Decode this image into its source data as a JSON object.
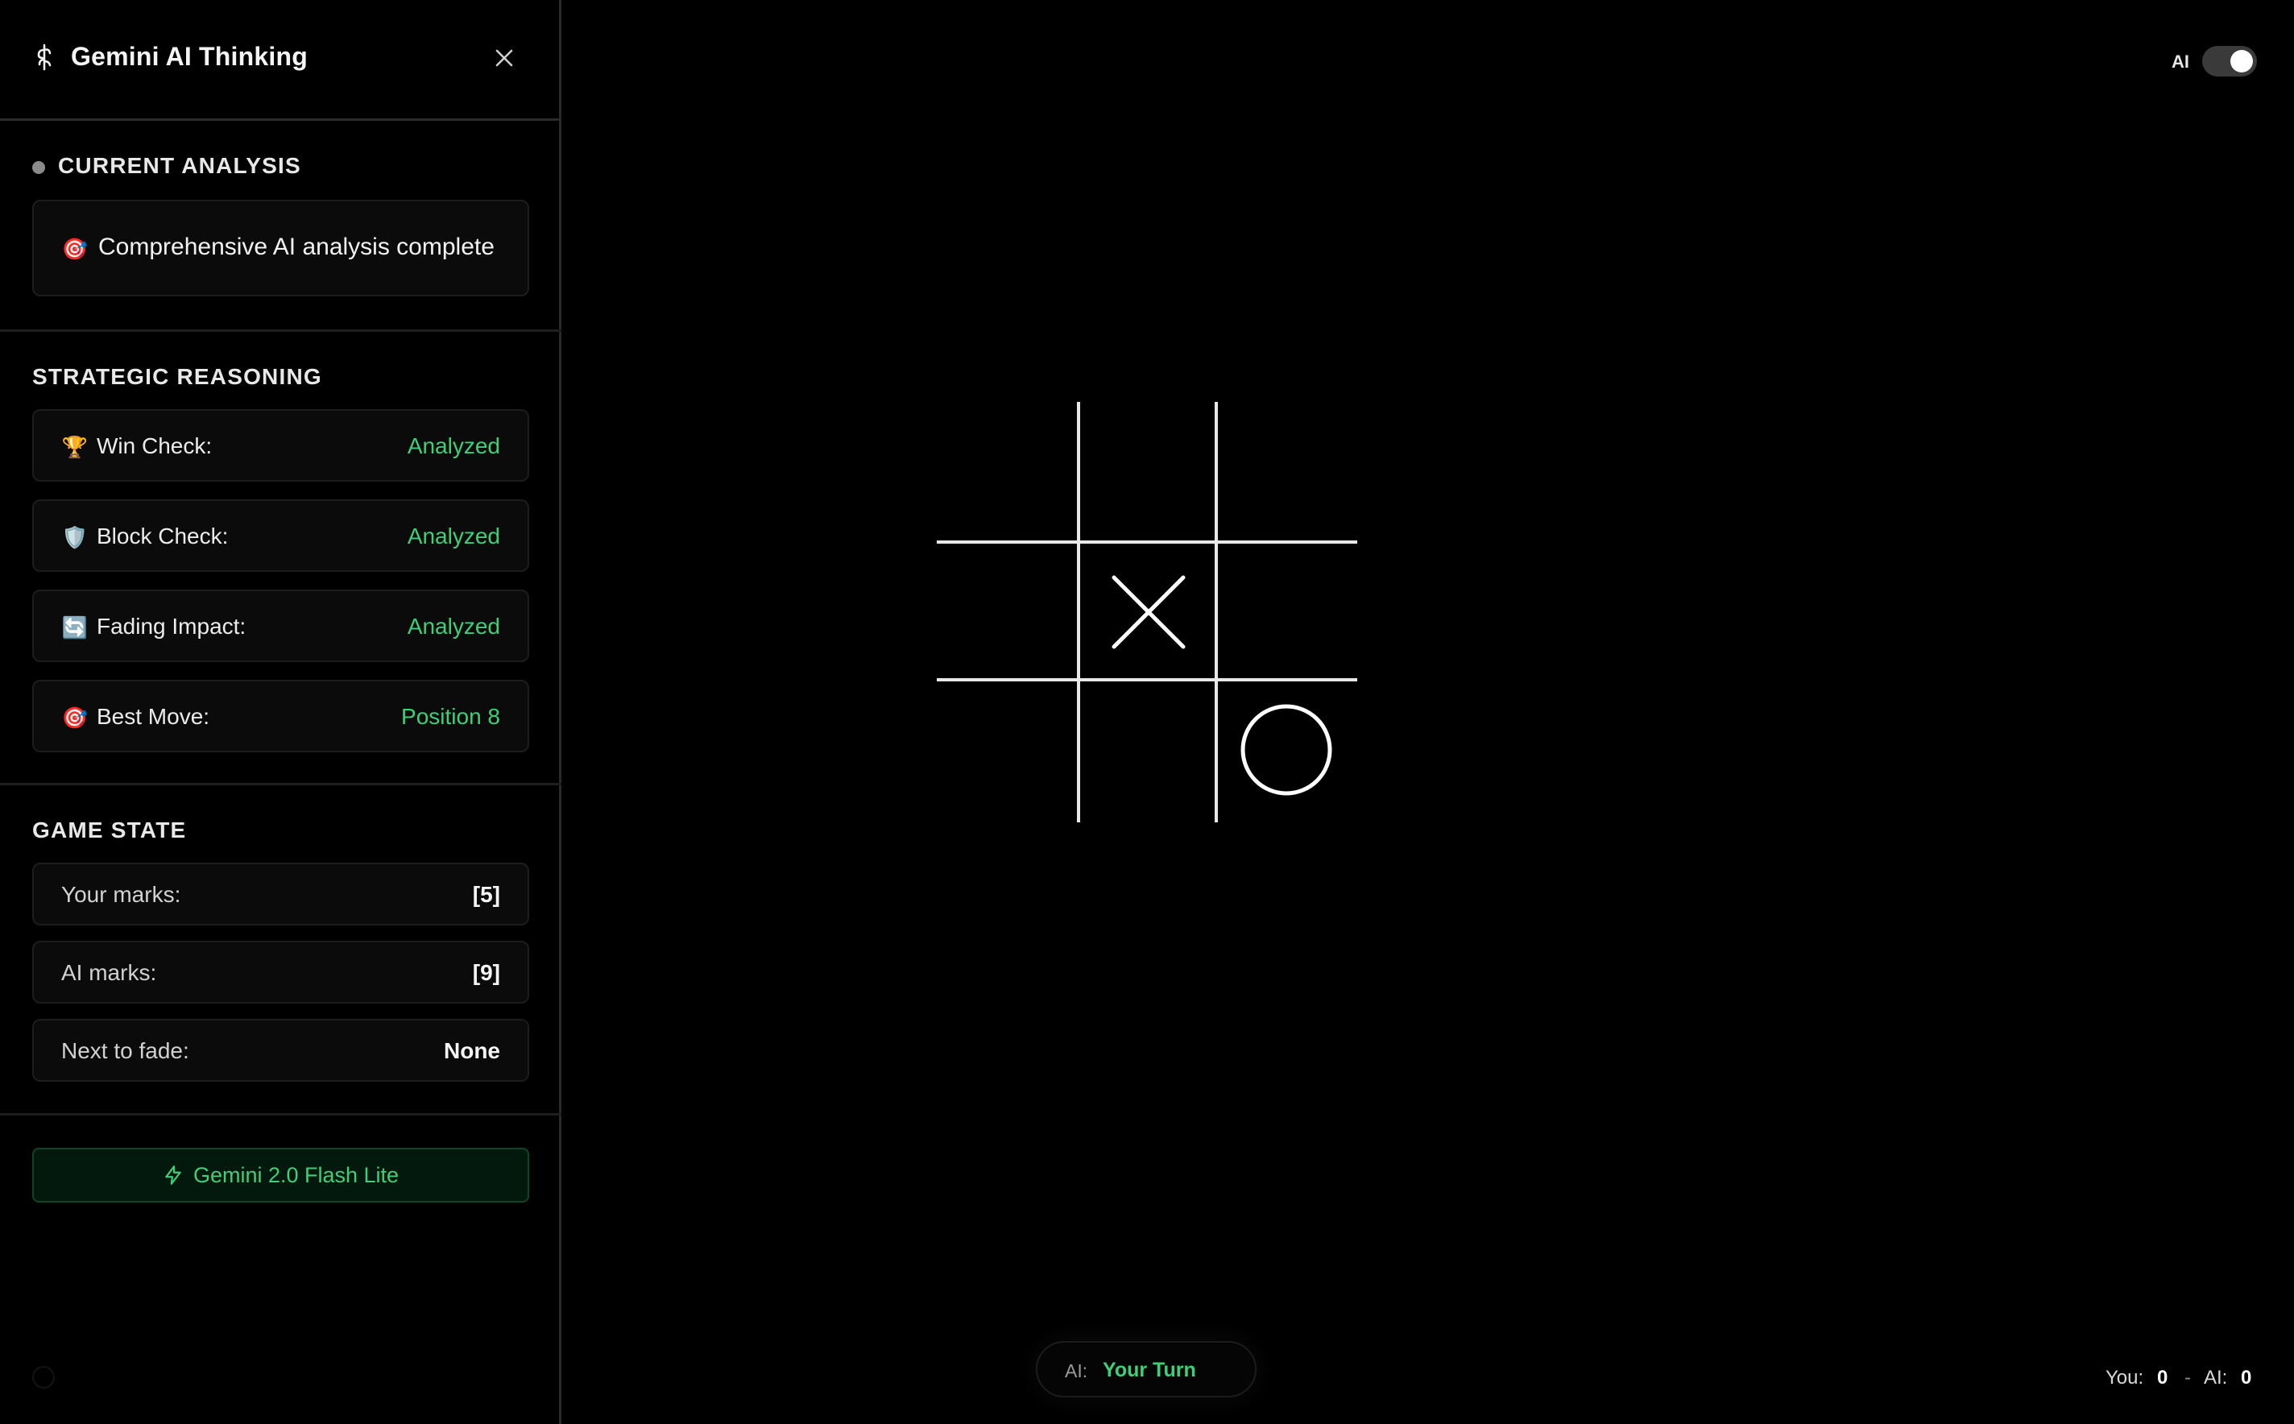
{
  "sidebar": {
    "title": "Gemini AI Thinking",
    "current_analysis": {
      "heading": "CURRENT ANALYSIS",
      "emoji": "🎯",
      "text": "Comprehensive AI analysis complete"
    },
    "strategic_reasoning": {
      "heading": "STRATEGIC REASONING",
      "items": [
        {
          "emoji": "🏆",
          "label": "Win Check:",
          "value": "Analyzed"
        },
        {
          "emoji": "🛡️",
          "label": "Block Check:",
          "value": "Analyzed"
        },
        {
          "emoji": "🔄",
          "label": "Fading Impact:",
          "value": "Analyzed"
        },
        {
          "emoji": "🎯",
          "label": "Best Move:",
          "value": "Position 8"
        }
      ]
    },
    "game_state": {
      "heading": "GAME STATE",
      "items": [
        {
          "label": "Your marks:",
          "value": "[5]"
        },
        {
          "label": "AI marks:",
          "value": "[9]"
        },
        {
          "label": "Next to fade:",
          "value": "None"
        }
      ]
    },
    "model_button": "Gemini 2.0 Flash Lite"
  },
  "toggle": {
    "label": "AI",
    "on": true
  },
  "board": {
    "cells": [
      "",
      "",
      "",
      "",
      "X",
      "",
      "",
      "",
      "O"
    ]
  },
  "status": {
    "label": "AI:",
    "value": "Your Turn"
  },
  "score": {
    "you_label": "You:",
    "you": "0",
    "separator": "-",
    "ai_label": "AI:",
    "ai": "0"
  },
  "colors": {
    "accent_green": "#3ecf79",
    "background": "#000000"
  }
}
